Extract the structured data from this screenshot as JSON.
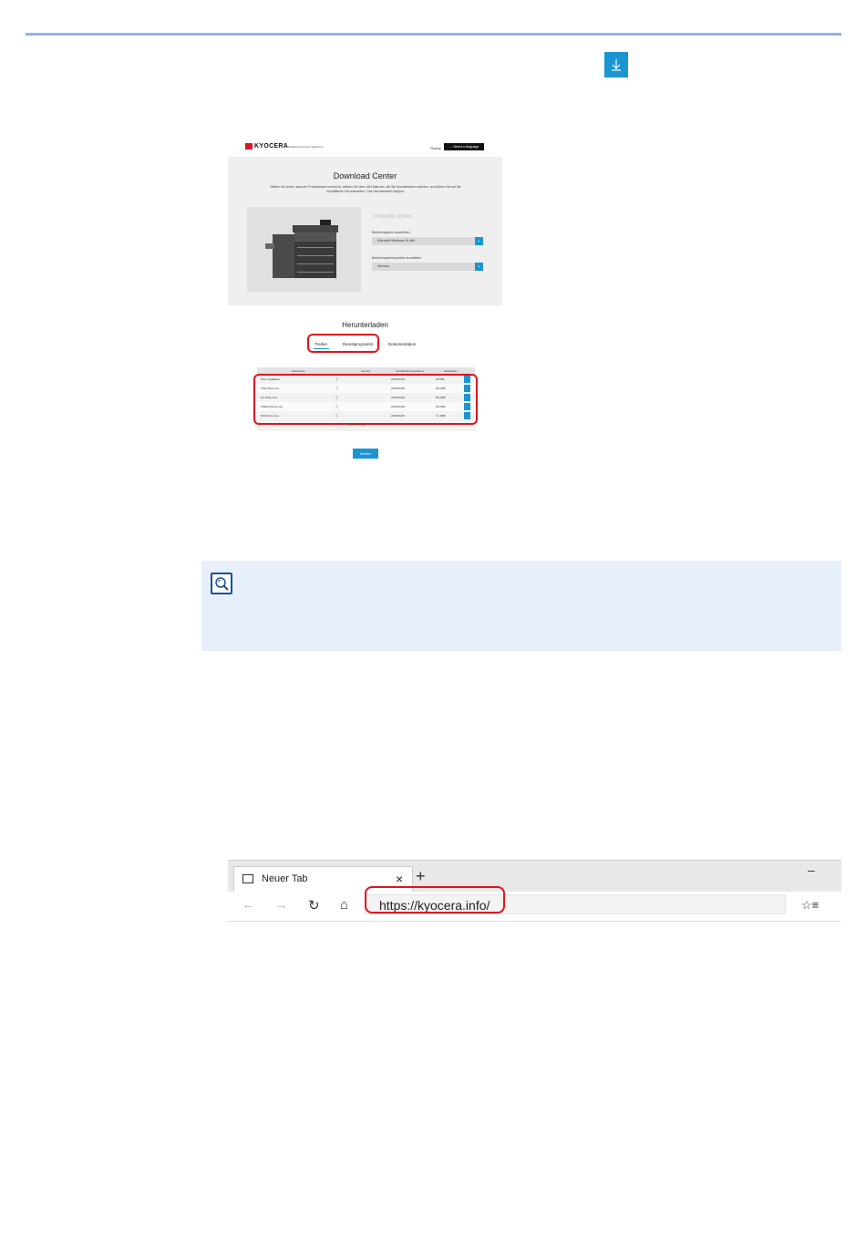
{
  "header": {
    "divider_color": "#8fb3e8"
  },
  "download_icon": {
    "name": "download-arrow-icon",
    "color": "#1a95d0"
  },
  "download_center": {
    "brand": "KYOCERA",
    "brand_sub": "KYOCERA Document Solutions",
    "global": "Global",
    "select_language": "→ Select a language",
    "title": "Download Center",
    "description": "Stellen Sie sicher, dass der Produktname korrekt ist, wählen Sie dann die Datei aus, die Sie herunterladen möchten, und klicken Sie auf die Schaltfläche 'Herunterladen'. Das Herunterladen beginnt.",
    "model_name": "TASKalfa 3554ci",
    "os_label": "Betriebssystem auswählen",
    "os_value": "Microsoft Windows 10 x64",
    "lang_label": "Betriebssystemsprache auswählen",
    "lang_value": "German",
    "section_title": "Herunterladen",
    "tabs": [
      "Treiber",
      "Dienstprogramm",
      "Dokumentation"
    ],
    "columns": [
      "Dateiname",
      "Version",
      "Veröffentlichungsdatum",
      "Dateigröße"
    ],
    "rows": [
      {
        "name": "Print Installation",
        "date": "2020/01/09",
        "size": "307MB"
      },
      {
        "name": "TSE Driver.exe",
        "date": "2020/01/09",
        "size": "95.2MB"
      },
      {
        "name": "KX Driver.exe",
        "date": "2020/01/09",
        "size": "95.2MB"
      },
      {
        "name": "TWAIN Driver.exe",
        "date": "2020/01/09",
        "size": "65.0MB"
      },
      {
        "name": "WIA Driver.exe",
        "date": "2020/01/09",
        "size": "14.4MB"
      }
    ],
    "more": "Mehr anzeigen",
    "submit": "Senden"
  },
  "browser": {
    "tab_title": "Neuer Tab",
    "tab_close": "×",
    "new_tab": "+",
    "minimize": "–",
    "back": "←",
    "forward": "→",
    "refresh": "↻",
    "home": "⌂",
    "url": "https://kyocera.info/",
    "favorites": "☆≡"
  }
}
